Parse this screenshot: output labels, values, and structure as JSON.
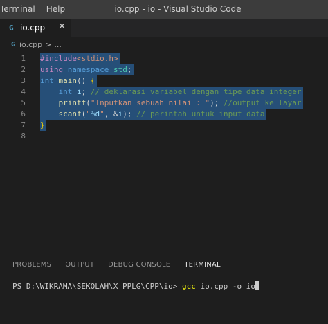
{
  "titlebar": {
    "menu": [
      "Terminal",
      "Help"
    ],
    "window_title": "io.cpp - io - Visual Studio Code"
  },
  "tabs": [
    {
      "label": "io.cpp",
      "icon": "G",
      "close": "✕"
    }
  ],
  "breadcrumb": {
    "file": "io.cpp",
    "separator": ">",
    "more": "..."
  },
  "editor": {
    "line_numbers": [
      "1",
      "2",
      "3",
      "4",
      "5",
      "6",
      "7",
      "8"
    ],
    "lines": [
      [
        {
          "t": "#include",
          "c": "k-pre"
        },
        {
          "t": "<stdio.h>",
          "c": "k-inc"
        }
      ],
      [
        {
          "t": "using",
          "c": "k-pre"
        },
        {
          "t": " ",
          "c": "k-pun"
        },
        {
          "t": "namespace",
          "c": "k-kw"
        },
        {
          "t": " ",
          "c": "k-pun"
        },
        {
          "t": "std",
          "c": "k-ns"
        },
        {
          "t": ";",
          "c": "k-pun"
        }
      ],
      [
        {
          "t": "int",
          "c": "k-kw"
        },
        {
          "t": " ",
          "c": "k-pun"
        },
        {
          "t": "main",
          "c": "k-fn"
        },
        {
          "t": "() ",
          "c": "k-pun"
        },
        {
          "t": "{",
          "c": "k-brace"
        }
      ],
      [
        {
          "t": "    ",
          "c": "k-pun"
        },
        {
          "t": "int",
          "c": "k-kw"
        },
        {
          "t": " ",
          "c": "k-pun"
        },
        {
          "t": "i",
          "c": "k-var"
        },
        {
          "t": "; ",
          "c": "k-pun"
        },
        {
          "t": "// deklarasi variabel dengan tipe data integer",
          "c": "k-cmt"
        }
      ],
      [
        {
          "t": "    ",
          "c": "k-pun"
        },
        {
          "t": "printf",
          "c": "k-fn"
        },
        {
          "t": "(",
          "c": "k-pun"
        },
        {
          "t": "\"Inputkan sebuah nilai : \"",
          "c": "k-str"
        },
        {
          "t": "); ",
          "c": "k-pun"
        },
        {
          "t": "//output ke layar",
          "c": "k-cmt"
        }
      ],
      [
        {
          "t": "    ",
          "c": "k-pun"
        },
        {
          "t": "scanf",
          "c": "k-fn"
        },
        {
          "t": "(",
          "c": "k-pun"
        },
        {
          "t": "\"",
          "c": "k-str"
        },
        {
          "t": "%d",
          "c": "k-fmt"
        },
        {
          "t": "\"",
          "c": "k-str"
        },
        {
          "t": ", &",
          "c": "k-pun"
        },
        {
          "t": "i",
          "c": "k-var"
        },
        {
          "t": "); ",
          "c": "k-pun"
        },
        {
          "t": "// perintah untuk input data",
          "c": "k-cmt"
        }
      ],
      [
        {
          "t": "}",
          "c": "k-brace"
        }
      ],
      []
    ]
  },
  "panel": {
    "tabs": [
      "PROBLEMS",
      "OUTPUT",
      "DEBUG CONSOLE",
      "TERMINAL"
    ],
    "active_tab": "TERMINAL",
    "terminal": {
      "prompt": "PS D:\\WIKRAMA\\SEKOLAH\\X PPLG\\CPP\\io> ",
      "command": "gcc",
      "args": " io.cpp -o io"
    }
  }
}
